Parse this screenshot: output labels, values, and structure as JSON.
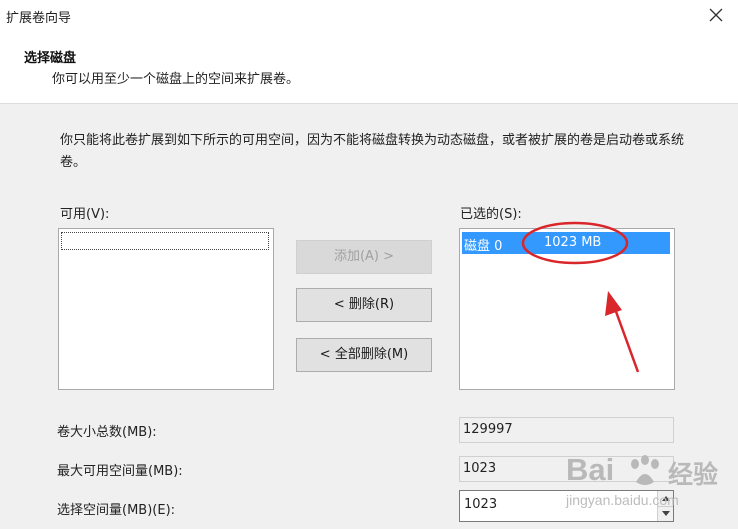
{
  "window": {
    "title": "扩展卷向导"
  },
  "header": {
    "title": "选择磁盘",
    "subtitle": "你可以用至少一个磁盘上的空间来扩展卷。"
  },
  "description": "你只能将此卷扩展到如下所示的可用空间，因为不能将磁盘转换为动态磁盘，或者被扩展的卷是启动卷或系统卷。",
  "available": {
    "label": "可用(V):"
  },
  "selected": {
    "label": "已选的(S):",
    "items": [
      {
        "disk": "磁盘 0",
        "size": "1023 MB"
      }
    ]
  },
  "buttons": {
    "add": "添加(A) >",
    "remove": "< 删除(R)",
    "remove_all": "< 全部删除(M)"
  },
  "fields": {
    "total_size": {
      "label": "卷大小总数(MB):",
      "value": "129997"
    },
    "max_available": {
      "label": "最大可用空间量(MB):",
      "value": "1023"
    },
    "select_amount": {
      "label": "选择空间量(MB)(E):",
      "value": "1023"
    }
  },
  "watermark": {
    "brand": "Bai",
    "brand_cn": "经验",
    "url": "jingyan.baidu.com"
  },
  "colors": {
    "selection": "#3399ff",
    "annotation": "#d9262b"
  },
  "icons": {
    "close": "close-icon",
    "spin_up": "chevron-up-icon",
    "spin_down": "chevron-down-icon"
  }
}
